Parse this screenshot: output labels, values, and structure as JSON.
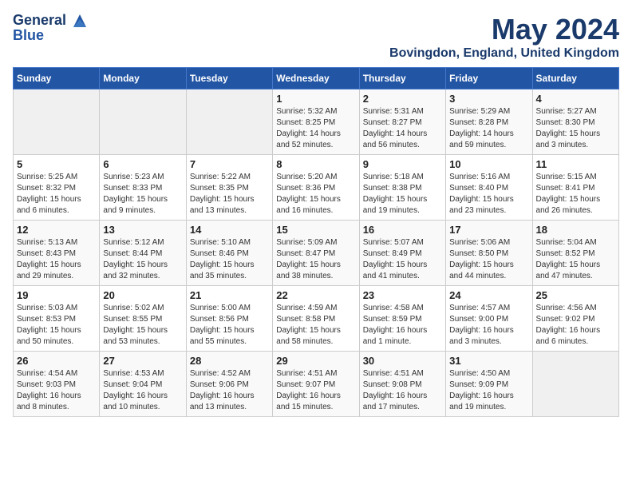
{
  "logo": {
    "line1": "General",
    "line2": "Blue"
  },
  "title": "May 2024",
  "location": "Bovingdon, England, United Kingdom",
  "weekdays": [
    "Sunday",
    "Monday",
    "Tuesday",
    "Wednesday",
    "Thursday",
    "Friday",
    "Saturday"
  ],
  "weeks": [
    [
      {
        "day": "",
        "info": ""
      },
      {
        "day": "",
        "info": ""
      },
      {
        "day": "",
        "info": ""
      },
      {
        "day": "1",
        "info": "Sunrise: 5:32 AM\nSunset: 8:25 PM\nDaylight: 14 hours and 52 minutes."
      },
      {
        "day": "2",
        "info": "Sunrise: 5:31 AM\nSunset: 8:27 PM\nDaylight: 14 hours and 56 minutes."
      },
      {
        "day": "3",
        "info": "Sunrise: 5:29 AM\nSunset: 8:28 PM\nDaylight: 14 hours and 59 minutes."
      },
      {
        "day": "4",
        "info": "Sunrise: 5:27 AM\nSunset: 8:30 PM\nDaylight: 15 hours and 3 minutes."
      }
    ],
    [
      {
        "day": "5",
        "info": "Sunrise: 5:25 AM\nSunset: 8:32 PM\nDaylight: 15 hours and 6 minutes."
      },
      {
        "day": "6",
        "info": "Sunrise: 5:23 AM\nSunset: 8:33 PM\nDaylight: 15 hours and 9 minutes."
      },
      {
        "day": "7",
        "info": "Sunrise: 5:22 AM\nSunset: 8:35 PM\nDaylight: 15 hours and 13 minutes."
      },
      {
        "day": "8",
        "info": "Sunrise: 5:20 AM\nSunset: 8:36 PM\nDaylight: 15 hours and 16 minutes."
      },
      {
        "day": "9",
        "info": "Sunrise: 5:18 AM\nSunset: 8:38 PM\nDaylight: 15 hours and 19 minutes."
      },
      {
        "day": "10",
        "info": "Sunrise: 5:16 AM\nSunset: 8:40 PM\nDaylight: 15 hours and 23 minutes."
      },
      {
        "day": "11",
        "info": "Sunrise: 5:15 AM\nSunset: 8:41 PM\nDaylight: 15 hours and 26 minutes."
      }
    ],
    [
      {
        "day": "12",
        "info": "Sunrise: 5:13 AM\nSunset: 8:43 PM\nDaylight: 15 hours and 29 minutes."
      },
      {
        "day": "13",
        "info": "Sunrise: 5:12 AM\nSunset: 8:44 PM\nDaylight: 15 hours and 32 minutes."
      },
      {
        "day": "14",
        "info": "Sunrise: 5:10 AM\nSunset: 8:46 PM\nDaylight: 15 hours and 35 minutes."
      },
      {
        "day": "15",
        "info": "Sunrise: 5:09 AM\nSunset: 8:47 PM\nDaylight: 15 hours and 38 minutes."
      },
      {
        "day": "16",
        "info": "Sunrise: 5:07 AM\nSunset: 8:49 PM\nDaylight: 15 hours and 41 minutes."
      },
      {
        "day": "17",
        "info": "Sunrise: 5:06 AM\nSunset: 8:50 PM\nDaylight: 15 hours and 44 minutes."
      },
      {
        "day": "18",
        "info": "Sunrise: 5:04 AM\nSunset: 8:52 PM\nDaylight: 15 hours and 47 minutes."
      }
    ],
    [
      {
        "day": "19",
        "info": "Sunrise: 5:03 AM\nSunset: 8:53 PM\nDaylight: 15 hours and 50 minutes."
      },
      {
        "day": "20",
        "info": "Sunrise: 5:02 AM\nSunset: 8:55 PM\nDaylight: 15 hours and 53 minutes."
      },
      {
        "day": "21",
        "info": "Sunrise: 5:00 AM\nSunset: 8:56 PM\nDaylight: 15 hours and 55 minutes."
      },
      {
        "day": "22",
        "info": "Sunrise: 4:59 AM\nSunset: 8:58 PM\nDaylight: 15 hours and 58 minutes."
      },
      {
        "day": "23",
        "info": "Sunrise: 4:58 AM\nSunset: 8:59 PM\nDaylight: 16 hours and 1 minute."
      },
      {
        "day": "24",
        "info": "Sunrise: 4:57 AM\nSunset: 9:00 PM\nDaylight: 16 hours and 3 minutes."
      },
      {
        "day": "25",
        "info": "Sunrise: 4:56 AM\nSunset: 9:02 PM\nDaylight: 16 hours and 6 minutes."
      }
    ],
    [
      {
        "day": "26",
        "info": "Sunrise: 4:54 AM\nSunset: 9:03 PM\nDaylight: 16 hours and 8 minutes."
      },
      {
        "day": "27",
        "info": "Sunrise: 4:53 AM\nSunset: 9:04 PM\nDaylight: 16 hours and 10 minutes."
      },
      {
        "day": "28",
        "info": "Sunrise: 4:52 AM\nSunset: 9:06 PM\nDaylight: 16 hours and 13 minutes."
      },
      {
        "day": "29",
        "info": "Sunrise: 4:51 AM\nSunset: 9:07 PM\nDaylight: 16 hours and 15 minutes."
      },
      {
        "day": "30",
        "info": "Sunrise: 4:51 AM\nSunset: 9:08 PM\nDaylight: 16 hours and 17 minutes."
      },
      {
        "day": "31",
        "info": "Sunrise: 4:50 AM\nSunset: 9:09 PM\nDaylight: 16 hours and 19 minutes."
      },
      {
        "day": "",
        "info": ""
      }
    ]
  ]
}
